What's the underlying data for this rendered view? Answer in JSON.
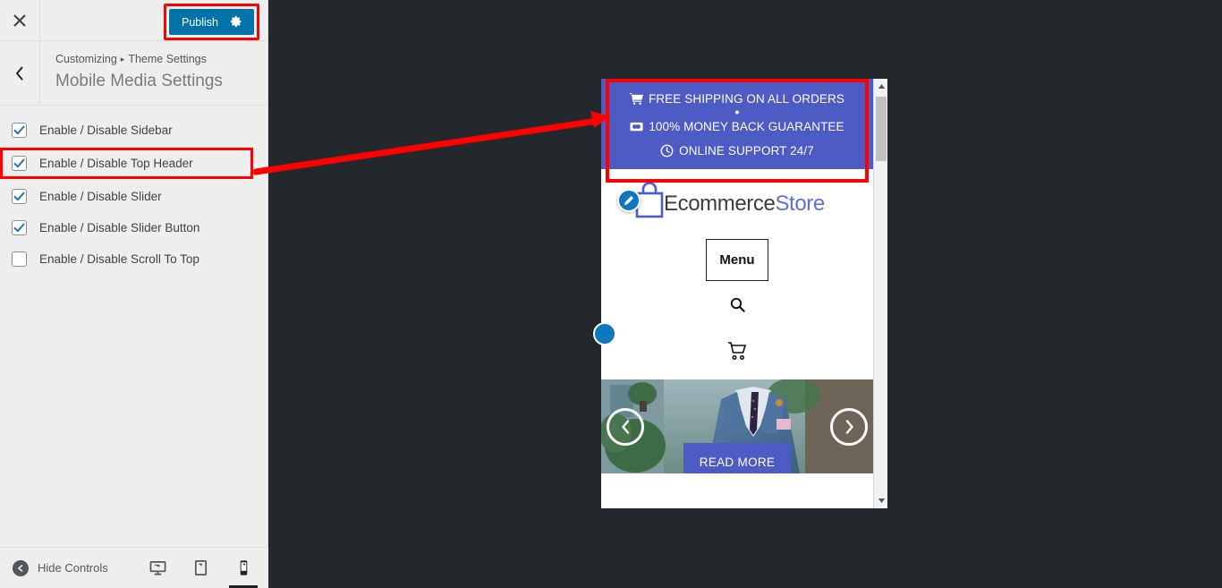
{
  "customizer": {
    "close_icon": "close-icon",
    "publish_label": "Publish",
    "publish_gear_icon": "gear-icon",
    "back_icon": "chevron-left-icon",
    "breadcrumb": {
      "root": "Customizing",
      "separator": "▸",
      "section": "Theme Settings"
    },
    "panel_title": "Mobile Media Settings",
    "controls": [
      {
        "label": "Enable / Disable Sidebar",
        "checked": true,
        "highlighted": false
      },
      {
        "label": "Enable / Disable Top Header",
        "checked": true,
        "highlighted": true
      },
      {
        "label": "Enable / Disable Slider",
        "checked": true,
        "highlighted": false
      },
      {
        "label": "Enable / Disable Slider Button",
        "checked": true,
        "highlighted": false
      },
      {
        "label": "Enable / Disable Scroll To Top",
        "checked": false,
        "highlighted": false
      }
    ],
    "footer": {
      "hide_controls_label": "Hide Controls",
      "devices": [
        {
          "name": "desktop",
          "icon": "desktop-icon",
          "active": false
        },
        {
          "name": "tablet",
          "icon": "tablet-icon",
          "active": false
        },
        {
          "name": "mobile",
          "icon": "mobile-icon",
          "active": true
        }
      ]
    }
  },
  "preview": {
    "top_banner": {
      "line1": "FREE SHIPPING ON ALL ORDERS",
      "line1_icon": "shopping-cart-icon",
      "separator_dot": "●",
      "line2": "100% MONEY BACK GUARANTEE",
      "line2_icon": "money-back-icon",
      "line3": "ONLINE SUPPORT 24/7",
      "line3_icon": "clock-icon"
    },
    "logo": {
      "edit_icon": "edit-pencil-icon",
      "mark_icon": "shopping-bag-icon",
      "text_primary": "Ecommerce",
      "text_accent": "Store"
    },
    "menu_label": "Menu",
    "search_icon": "search-icon",
    "cart_icon": "shopping-cart-icon",
    "slider": {
      "prev_icon": "chevron-left-icon",
      "next_icon": "chevron-right-icon",
      "button_label": "READ MORE"
    },
    "scrollbar": {
      "up_icon": "triangle-up-icon",
      "down_icon": "triangle-down-icon"
    }
  },
  "colors": {
    "wp_blue": "#0073aa",
    "banner_blue": "#4f5bc4",
    "annotation_red": "#ff0000",
    "panel_bg": "#eeeeee",
    "preview_bg": "#23282d",
    "logo_accent": "#5e6fe0"
  }
}
